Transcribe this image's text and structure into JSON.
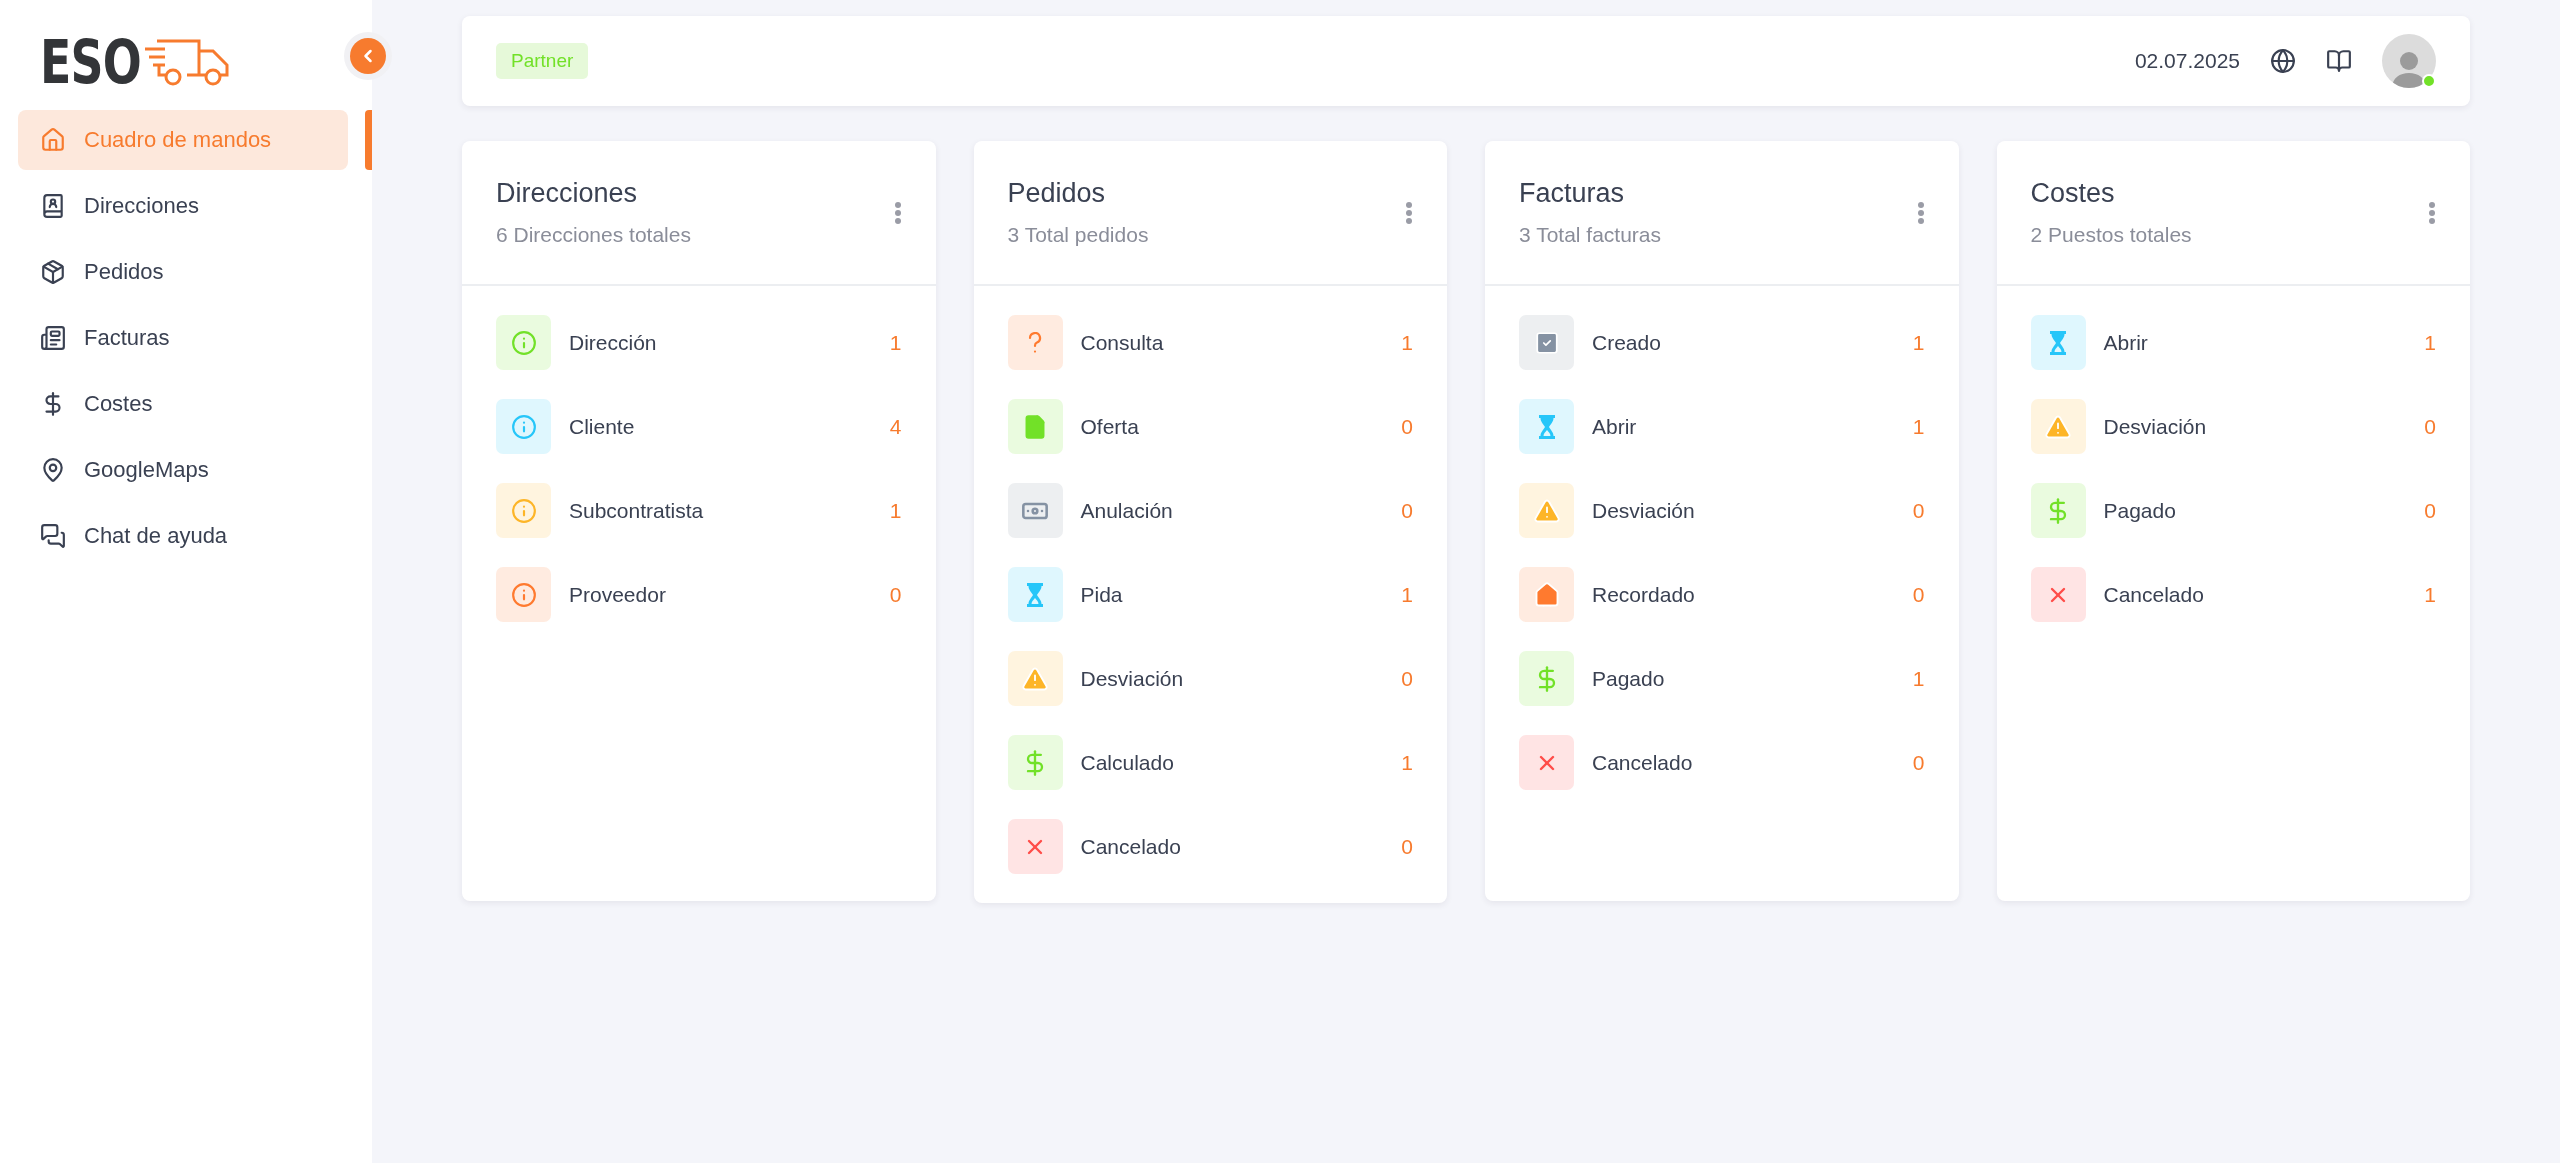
{
  "sidebar": {
    "logo_text": "ESO",
    "items": [
      {
        "label": "Cuadro de mandos",
        "kind": "home",
        "selected": true
      },
      {
        "label": "Direcciones",
        "kind": "contacts",
        "selected": false
      },
      {
        "label": "Pedidos",
        "kind": "box",
        "selected": false
      },
      {
        "label": "Facturas",
        "kind": "invoice",
        "selected": false
      },
      {
        "label": "Costes",
        "kind": "dollar",
        "selected": false
      },
      {
        "label": "GoogleMaps",
        "kind": "pin",
        "selected": false
      },
      {
        "label": "Chat de ayuda",
        "kind": "chat",
        "selected": false
      }
    ]
  },
  "header": {
    "badge": "Partner",
    "date": "02.07.2025",
    "user_online": true
  },
  "cards": [
    {
      "title": "Direcciones",
      "subtitle": "6 Direcciones totales",
      "rows": [
        {
          "label": "Dirección",
          "count": "1",
          "kind": "info",
          "color": "#72e128"
        },
        {
          "label": "Cliente",
          "count": "4",
          "kind": "info",
          "color": "#26c6f9"
        },
        {
          "label": "Subcontratista",
          "count": "1",
          "kind": "info",
          "color": "#fdb528"
        },
        {
          "label": "Proveedor",
          "count": "0",
          "kind": "info",
          "color": "#ff7a2f"
        }
      ]
    },
    {
      "title": "Pedidos",
      "subtitle": "3 Total pedidos",
      "rows": [
        {
          "label": "Consulta",
          "count": "1",
          "kind": "question",
          "color": "#ff7a2f"
        },
        {
          "label": "Oferta",
          "count": "0",
          "kind": "file",
          "color": "#72e128"
        },
        {
          "label": "Anulación",
          "count": "0",
          "kind": "money",
          "color": "#8592a3"
        },
        {
          "label": "Pida",
          "count": "1",
          "kind": "hourglass",
          "color": "#26c6f9"
        },
        {
          "label": "Desviación",
          "count": "0",
          "kind": "warning",
          "color": "#fdb528"
        },
        {
          "label": "Calculado",
          "count": "1",
          "kind": "dollar",
          "color": "#72e128"
        },
        {
          "label": "Cancelado",
          "count": "0",
          "kind": "close",
          "color": "#ff4d49"
        }
      ]
    },
    {
      "title": "Facturas",
      "subtitle": "3 Total facturas",
      "rows": [
        {
          "label": "Creado",
          "count": "1",
          "kind": "check",
          "color": "#8592a3"
        },
        {
          "label": "Abrir",
          "count": "1",
          "kind": "hourglass",
          "color": "#26c6f9"
        },
        {
          "label": "Desviación",
          "count": "0",
          "kind": "warning",
          "color": "#fdb528"
        },
        {
          "label": "Recordado",
          "count": "0",
          "kind": "house",
          "color": "#ff7a2f"
        },
        {
          "label": "Pagado",
          "count": "1",
          "kind": "dollar",
          "color": "#72e128"
        },
        {
          "label": "Cancelado",
          "count": "0",
          "kind": "close",
          "color": "#ff4d49"
        }
      ]
    },
    {
      "title": "Costes",
      "subtitle": "2 Puestos totales",
      "rows": [
        {
          "label": "Abrir",
          "count": "1",
          "kind": "hourglass",
          "color": "#26c6f9"
        },
        {
          "label": "Desviación",
          "count": "0",
          "kind": "warning",
          "color": "#fdb528"
        },
        {
          "label": "Pagado",
          "count": "0",
          "kind": "dollar",
          "color": "#72e128"
        },
        {
          "label": "Cancelado",
          "count": "1",
          "kind": "close",
          "color": "#ff4d49"
        }
      ]
    }
  ]
}
